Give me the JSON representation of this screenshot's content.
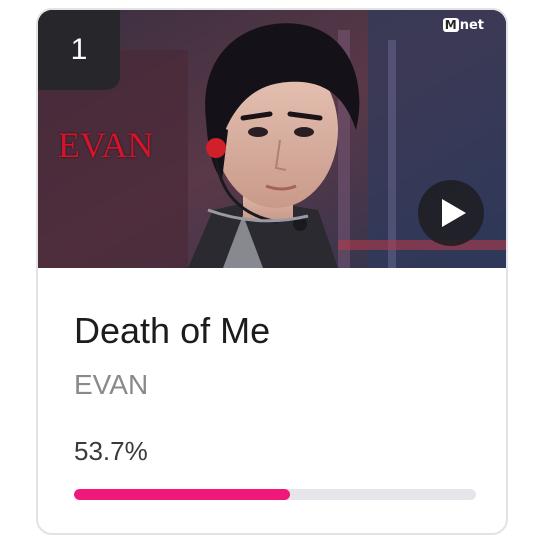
{
  "card": {
    "rank": "1",
    "channel_logo_text": "net",
    "channel_logo_mark": "M",
    "video_caption": "EVAN",
    "play_icon": "play-icon",
    "song_title": "Death of Me",
    "artist": "EVAN",
    "vote_percent_label": "53.7%",
    "vote_percent_value": 53.7
  },
  "colors": {
    "accent": "#f0197a",
    "track": "#e6e6ea",
    "badge": "#26262b",
    "caption": "#d4142c"
  }
}
